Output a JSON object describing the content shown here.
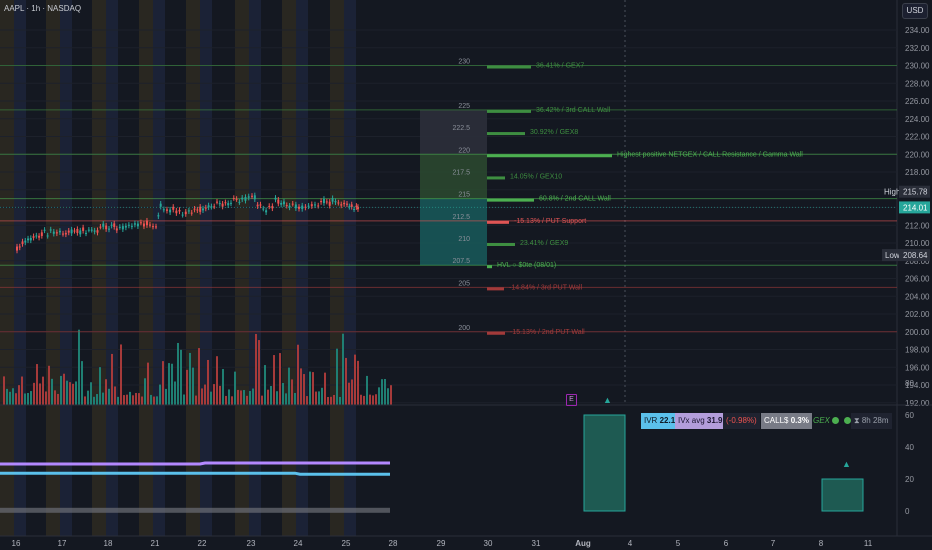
{
  "header": {
    "title": "AAPL · 1h · NASDAQ",
    "currency": "USD"
  },
  "price_axis": {
    "ticks": [
      "234.00",
      "232.00",
      "230.00",
      "228.00",
      "226.00",
      "224.00",
      "222.00",
      "220.00",
      "218.00",
      "216.00",
      "214.00",
      "212.00",
      "210.00",
      "208.00",
      "206.00",
      "204.00",
      "202.00",
      "200.00",
      "198.00",
      "196.00",
      "194.00",
      "192.00"
    ],
    "high_label": "High",
    "high_value": "215.78",
    "last_value": "214.01",
    "low_label": "Low",
    "low_value": "208.64"
  },
  "time_axis": {
    "ticks": [
      "16",
      "17",
      "18",
      "21",
      "22",
      "23",
      "24",
      "25",
      "28",
      "29",
      "30",
      "31",
      "Aug",
      "4",
      "5",
      "6",
      "7",
      "8",
      "11"
    ]
  },
  "osc_axis": {
    "ticks": [
      "80",
      "60",
      "40",
      "20",
      "0"
    ]
  },
  "levels": [
    {
      "strike": "230",
      "label": "36.41% / GEX7",
      "bar": [
        487,
        531
      ],
      "color": "#3e8e41",
      "line": true
    },
    {
      "strike": "225",
      "label": "36.42% / 3rd CALL Wall",
      "bar": [
        487,
        531
      ],
      "color": "#3e8e41",
      "line": true
    },
    {
      "strike": "222.5",
      "label": "30.92% / GEX8",
      "bar": [
        487,
        525
      ],
      "color": "#3e8e41",
      "line": false
    },
    {
      "strike": "220",
      "label": "Highest positive NETGEX / CALL Resistance / Gamma Wall",
      "bar": [
        487,
        612
      ],
      "color": "#4caf50",
      "line": true
    },
    {
      "strike": "217.5",
      "label": "14.05% / GEX10",
      "bar": [
        487,
        505
      ],
      "color": "#3e8e41",
      "line": false
    },
    {
      "strike": "215",
      "label": "60.8% / 2nd CALL Wall",
      "bar": [
        487,
        534
      ],
      "color": "#4caf50",
      "line": true
    },
    {
      "strike": "212.5",
      "label": "-15.13% / PUT Support",
      "bar": [
        487,
        509
      ],
      "color": "#e05555",
      "line": true
    },
    {
      "strike": "210",
      "label": "23.41% / GEX9",
      "bar": [
        487,
        515
      ],
      "color": "#3e8e41",
      "line": false
    },
    {
      "strike": "207.5",
      "label": "HVL ○ $0te (08/01)",
      "bar": [
        487,
        492
      ],
      "color": "#4caf50",
      "line": true
    },
    {
      "strike": "205",
      "label": "-14.84% / 3rd PUT Wall",
      "bar": [
        487,
        504
      ],
      "color": "#a33a3a",
      "line": true
    },
    {
      "strike": "200",
      "label": "-15.13% / 2nd PUT Wall",
      "bar": [
        487,
        505
      ],
      "color": "#a33a3a",
      "line": true
    }
  ],
  "panel": {
    "ivr_label": "IVR",
    "ivr_value": "22.1",
    "ivx_label": "IVx avg",
    "ivx_value": "31.9",
    "change": "(-0.98%)",
    "calls_label": "CALL$",
    "calls_value": "0.3%",
    "gex_label": "GEX",
    "timer": "8h 28m",
    "e_marker": "E"
  },
  "chart_data": {
    "type": "candlestick",
    "symbol": "AAPL",
    "interval": "1h",
    "exchange": "NASDAQ",
    "ylim": [
      191,
      235
    ],
    "high": 215.78,
    "low": 208.64,
    "last": 214.01,
    "close_path": [
      [
        16,
        209.4
      ],
      [
        16.3,
        210.7
      ],
      [
        16.6,
        211.0
      ],
      [
        17,
        211.3
      ],
      [
        17.5,
        211.5
      ],
      [
        18,
        211.8
      ],
      [
        18.5,
        211.7
      ],
      [
        21,
        212.2
      ],
      [
        21.1,
        214.4
      ],
      [
        21.3,
        213.7
      ],
      [
        21.7,
        213.3
      ],
      [
        22,
        213.8
      ],
      [
        22.4,
        214.5
      ],
      [
        22.8,
        215.1
      ],
      [
        23,
        215.3
      ],
      [
        23.3,
        213.5
      ],
      [
        23.5,
        214.6
      ],
      [
        23.8,
        214.3
      ],
      [
        24,
        213.9
      ],
      [
        24.4,
        214.4
      ],
      [
        24.7,
        214.8
      ],
      [
        25,
        214.3
      ],
      [
        25.3,
        214.4
      ],
      [
        25.6,
        214.0
      ],
      [
        25.8,
        213.9
      ]
    ],
    "volume_max_hint": "bars in lower price region",
    "oscillator": {
      "purple_level": 30,
      "blue_level": 23,
      "forecast_boxes": [
        {
          "x": [
            "30",
            "31"
          ],
          "top": 60,
          "bottom": 0
        },
        {
          "x": [
            "8",
            "8"
          ],
          "top": 20,
          "bottom": 0
        }
      ]
    }
  }
}
